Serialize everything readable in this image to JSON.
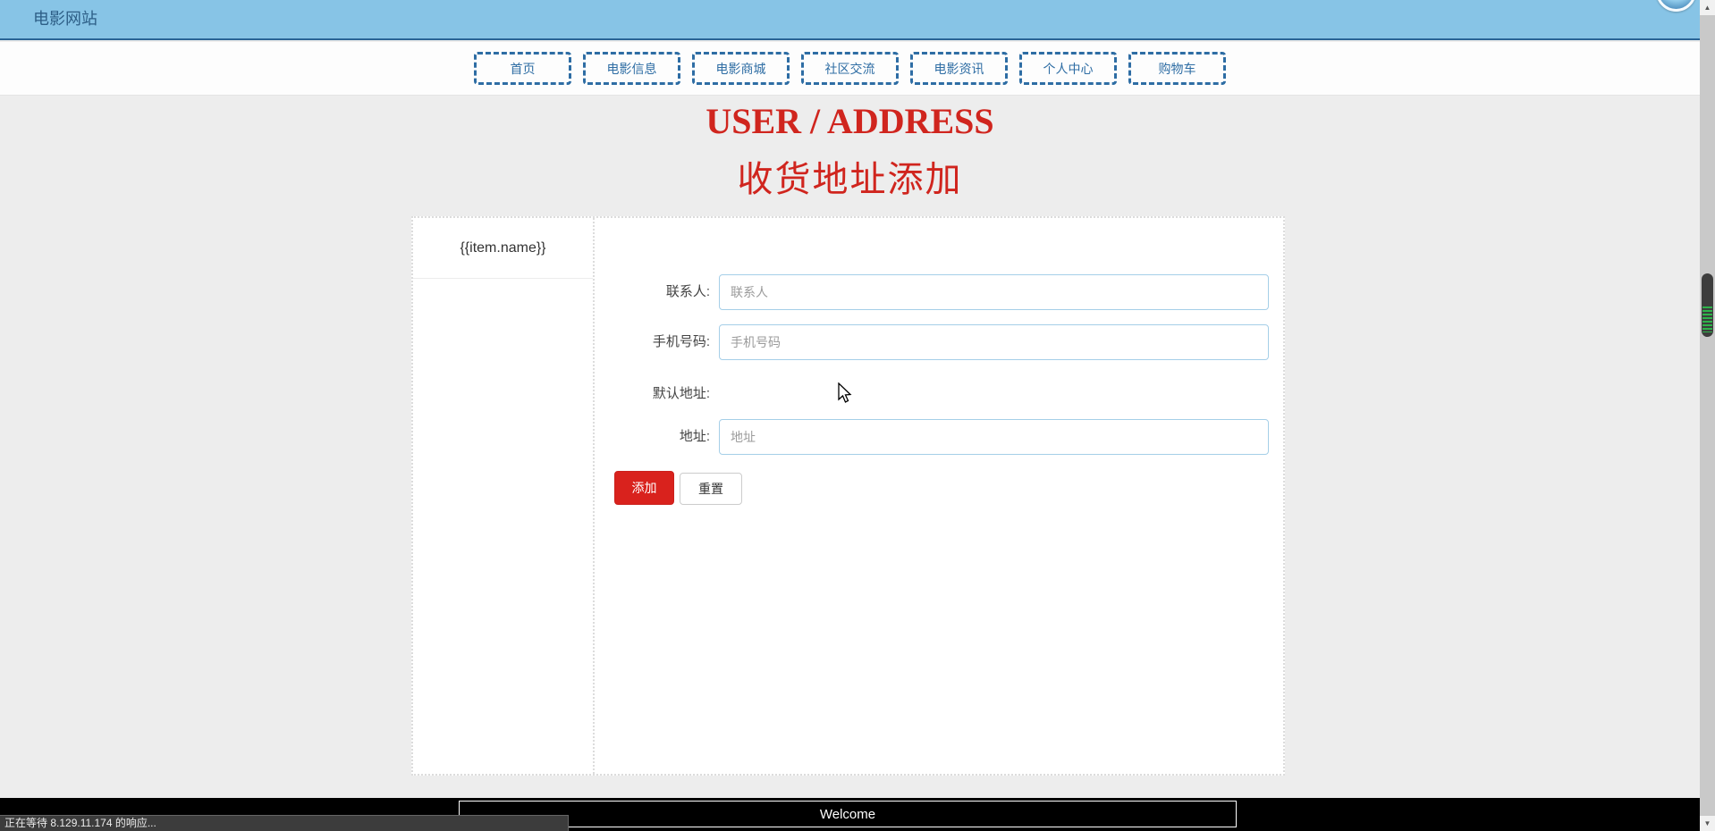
{
  "header": {
    "title": "电影网站"
  },
  "nav": {
    "items": [
      "首页",
      "电影信息",
      "电影商城",
      "社区交流",
      "电影资讯",
      "个人中心",
      "购物车"
    ]
  },
  "page": {
    "title_en": "USER / ADDRESS",
    "title_zh": "收货地址添加"
  },
  "sidebar": {
    "item_label": "{{item.name}}"
  },
  "form": {
    "fields": [
      {
        "label": "联系人:",
        "placeholder": "联系人",
        "value": ""
      },
      {
        "label": "手机号码:",
        "placeholder": "手机号码",
        "value": ""
      },
      {
        "label": "默认地址:",
        "placeholder": "",
        "value": ""
      },
      {
        "label": "地址:",
        "placeholder": "地址",
        "value": ""
      }
    ],
    "submit_label": "添加",
    "reset_label": "重置"
  },
  "footer": {
    "welcome_label": "Welcome"
  },
  "browser": {
    "status_text": "正在等待 8.129.11.174 的响应..."
  },
  "icons": {
    "scroll_up": "▲",
    "scroll_down": "▼"
  },
  "colors": {
    "header_bg": "#87c4e6",
    "header_border": "#2a6496",
    "nav_blue": "#2e6da4",
    "heading_red": "#d0251e",
    "add_button_red": "#d9221d",
    "input_border": "#a5cfe8",
    "body_bg": "#ededed",
    "footer_bg": "#000000",
    "stripe_green": "#2eb34a"
  }
}
